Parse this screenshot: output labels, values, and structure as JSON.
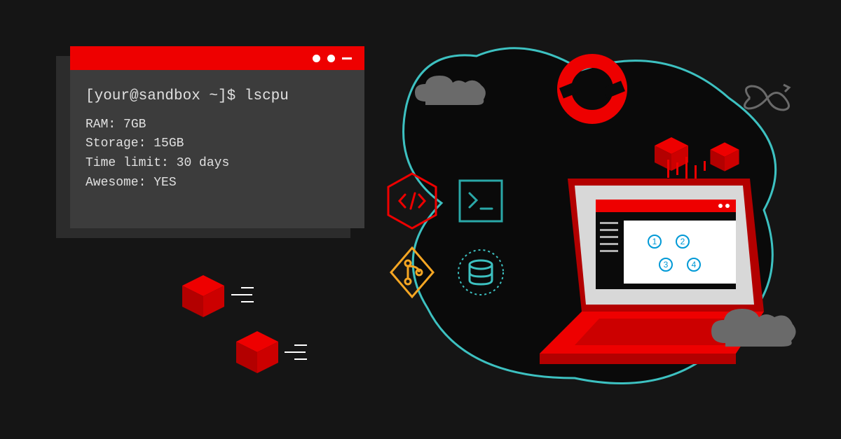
{
  "terminal": {
    "prompt": "[your@sandbox ~]$",
    "command": "lscpu",
    "output": [
      {
        "label": "RAM",
        "value": "7GB"
      },
      {
        "label": "Storage",
        "value": "15GB"
      },
      {
        "label": "Time limit",
        "value": "30 days"
      },
      {
        "label": "Awesome",
        "value": "YES"
      }
    ]
  },
  "laptop": {
    "steps": [
      "1",
      "2",
      "3",
      "4"
    ]
  },
  "colors": {
    "accent_red": "#ee0000",
    "dark_red": "#b30000",
    "teal": "#2aa8a8",
    "orange": "#f5a623",
    "cyan": "#3dc1c1",
    "gray": "#6a6a6a"
  },
  "icons": {
    "code": "code-hex-icon",
    "terminal": "terminal-hex-icon",
    "git": "git-branch-hex-icon",
    "database": "database-icon",
    "openshift": "openshift-ring-icon",
    "infinity": "infinity-loop-icon",
    "cloud": "cloud-icon",
    "cube": "3d-cube-icon"
  }
}
